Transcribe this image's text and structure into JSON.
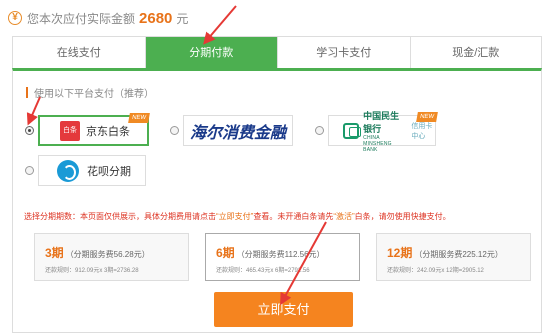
{
  "amount": {
    "label": "您本次应付实际金额",
    "value": "2680",
    "unit": "元"
  },
  "tabs": [
    {
      "label": "在线支付",
      "active": false
    },
    {
      "label": "分期付款",
      "active": true
    },
    {
      "label": "学习卡支付",
      "active": false
    },
    {
      "label": "现金/汇款",
      "active": false
    }
  ],
  "section": {
    "title": "使用以下平台支付（推荐）"
  },
  "options": {
    "jd": {
      "label": "京东白条",
      "logo": "白条",
      "badge": "NEW",
      "selected": true
    },
    "haier": {
      "label": "海尔消费金融",
      "selected": false
    },
    "minsheng": {
      "name": "中国民生银行",
      "en": "CHINA MINSHENG BANK",
      "sub": "信用卡中心",
      "badge": "NEW",
      "selected": false
    },
    "huabei": {
      "label": "花呗分期",
      "selected": false
    }
  },
  "notice": {
    "part1": "选择分期期数：本页面仅供展示，具体分期费用请点击",
    "highlight1": "“立即支付”",
    "part2": "查看。未开通白条请先",
    "highlight2": "“激活”",
    "part3": "白条，请勿使用快捷支付。"
  },
  "plans": [
    {
      "period": "3期",
      "fee": "（分期服务费56.28元）",
      "detail": "还款规则：912.09元x 3期=2736.28",
      "selected": false
    },
    {
      "period": "6期",
      "fee": "（分期服务费112.56元）",
      "detail": "还款规则：465.43元x 6期=2792.56",
      "selected": true
    },
    {
      "period": "12期",
      "fee": "（分期服务费225.12元）",
      "detail": "还款规则：242.09元x 12期=2905.12",
      "selected": false
    }
  ],
  "pay_button": {
    "label": "立即支付"
  },
  "colors": {
    "accent_green": "#4caf50",
    "accent_orange": "#f5841f",
    "annotation_red": "#e53935"
  }
}
